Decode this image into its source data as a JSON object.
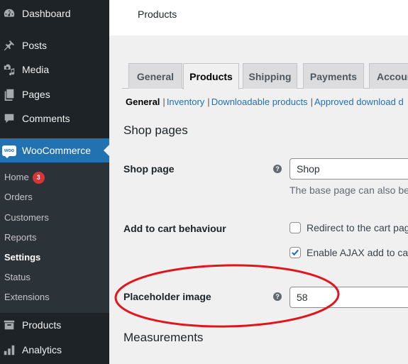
{
  "sidebar": {
    "items": [
      {
        "label": "Dashboard",
        "icon": "dashboard-icon"
      },
      {
        "label": "Posts",
        "icon": "pin-icon"
      },
      {
        "label": "Media",
        "icon": "media-icon"
      },
      {
        "label": "Pages",
        "icon": "pages-icon"
      },
      {
        "label": "Comments",
        "icon": "comment-icon"
      },
      {
        "label": "WooCommerce",
        "icon": "woo-icon",
        "logo_text": "woo"
      },
      {
        "label": "Products",
        "icon": "archive-icon"
      },
      {
        "label": "Analytics",
        "icon": "bar-chart-icon"
      }
    ],
    "submenu": [
      {
        "label": "Home",
        "badge": "3"
      },
      {
        "label": "Orders"
      },
      {
        "label": "Customers"
      },
      {
        "label": "Reports"
      },
      {
        "label": "Settings"
      },
      {
        "label": "Status"
      },
      {
        "label": "Extensions"
      }
    ],
    "accent_color": "#2271b1"
  },
  "header": {
    "title": "Products"
  },
  "tabs": [
    {
      "label": "General"
    },
    {
      "label": "Products"
    },
    {
      "label": "Shipping"
    },
    {
      "label": "Payments"
    },
    {
      "label": "Accounts"
    }
  ],
  "sections": {
    "current": "General",
    "links": [
      "Inventory",
      "Downloadable products",
      "Approved download d"
    ]
  },
  "shop_pages": {
    "heading": "Shop pages",
    "shop_page": {
      "label": "Shop page",
      "help": "?",
      "value": "Shop",
      "description": "The base page can also be"
    },
    "add_to_cart": {
      "label": "Add to cart behaviour",
      "options": [
        {
          "label": "Redirect to the cart page",
          "checked": false
        },
        {
          "label": "Enable AJAX add to cart",
          "checked": true
        }
      ]
    },
    "placeholder_image": {
      "label": "Placeholder image",
      "help": "?",
      "value": "58"
    }
  },
  "measurements": {
    "heading": "Measurements"
  },
  "annotation": {
    "color": "#e0161b",
    "shape": "ellipse-highlight"
  }
}
